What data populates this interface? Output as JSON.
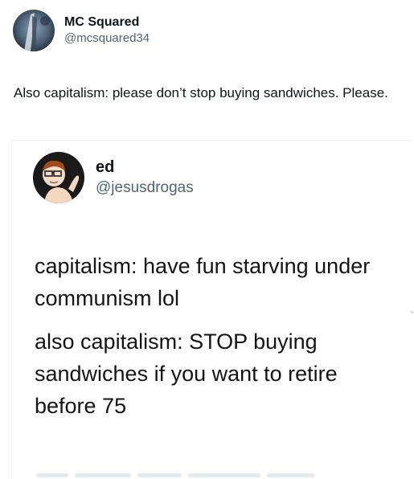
{
  "tweet": {
    "author": {
      "display_name": "MC Squared",
      "handle": "@mcsquared34",
      "avatar_icon": "profile-avatar-icon"
    },
    "text": "Also capitalism: please don’t stop buying sandwiches. Please."
  },
  "embedded_tweet": {
    "author": {
      "display_name": "ed",
      "handle": "@jesusdrogas",
      "avatar_icon": "cartoon-avatar-icon"
    },
    "paragraphs": [
      "capitalism: have fun starving under communism lol",
      "also capitalism: STOP buying sandwiches if you want to retire before 75"
    ]
  },
  "colors": {
    "text": "#0f1419",
    "secondary_text": "#536471",
    "background": "#ffffff"
  }
}
